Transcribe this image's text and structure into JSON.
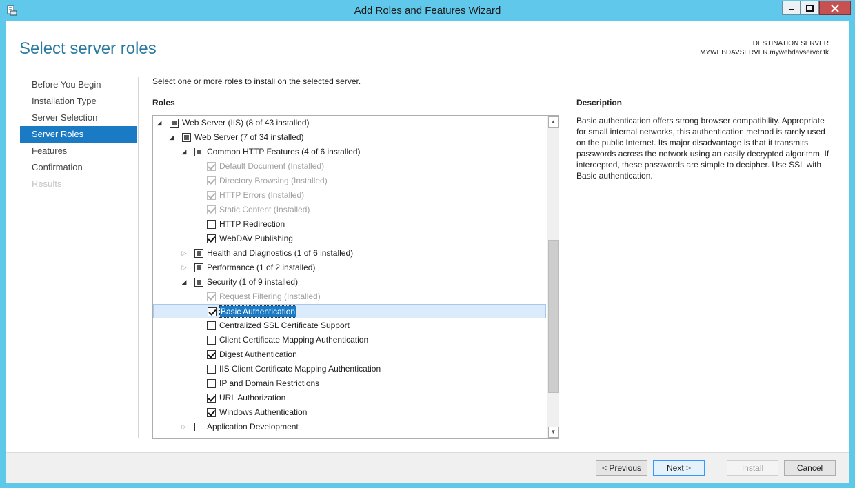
{
  "window": {
    "title": "Add Roles and Features Wizard"
  },
  "header": {
    "page_title": "Select server roles",
    "destination_label": "DESTINATION SERVER",
    "destination_server": "MYWEBDAVSERVER.mywebdavserver.tk"
  },
  "nav": {
    "items": [
      {
        "label": "Before You Begin",
        "state": "normal"
      },
      {
        "label": "Installation Type",
        "state": "normal"
      },
      {
        "label": "Server Selection",
        "state": "normal"
      },
      {
        "label": "Server Roles",
        "state": "active"
      },
      {
        "label": "Features",
        "state": "normal"
      },
      {
        "label": "Confirmation",
        "state": "normal"
      },
      {
        "label": "Results",
        "state": "disabled"
      }
    ]
  },
  "main": {
    "instruction": "Select one or more roles to install on the selected server.",
    "roles_label": "Roles",
    "tree": [
      {
        "label": "Web Server (IIS) (8 of 43 installed)",
        "level": 0,
        "expander": "expanded",
        "check": "partial",
        "disabled": false
      },
      {
        "label": "Web Server (7 of 34 installed)",
        "level": 1,
        "expander": "expanded",
        "check": "partial",
        "disabled": false
      },
      {
        "label": "Common HTTP Features (4 of 6 installed)",
        "level": 2,
        "expander": "expanded",
        "check": "partial",
        "disabled": false
      },
      {
        "label": "Default Document (Installed)",
        "level": 3,
        "expander": "none",
        "check": "checked",
        "disabled": true
      },
      {
        "label": "Directory Browsing (Installed)",
        "level": 3,
        "expander": "none",
        "check": "checked",
        "disabled": true
      },
      {
        "label": "HTTP Errors (Installed)",
        "level": 3,
        "expander": "none",
        "check": "checked",
        "disabled": true
      },
      {
        "label": "Static Content (Installed)",
        "level": 3,
        "expander": "none",
        "check": "checked",
        "disabled": true
      },
      {
        "label": "HTTP Redirection",
        "level": 3,
        "expander": "none",
        "check": "unchecked",
        "disabled": false
      },
      {
        "label": "WebDAV Publishing",
        "level": 3,
        "expander": "none",
        "check": "checked",
        "disabled": false
      },
      {
        "label": "Health and Diagnostics (1 of 6 installed)",
        "level": 2,
        "expander": "collapsed",
        "check": "partial",
        "disabled": false
      },
      {
        "label": "Performance (1 of 2 installed)",
        "level": 2,
        "expander": "collapsed",
        "check": "partial",
        "disabled": false
      },
      {
        "label": "Security (1 of 9 installed)",
        "level": 2,
        "expander": "expanded",
        "check": "partial",
        "disabled": false
      },
      {
        "label": "Request Filtering (Installed)",
        "level": 3,
        "expander": "none",
        "check": "checked",
        "disabled": true
      },
      {
        "label": "Basic Authentication",
        "level": 3,
        "expander": "none",
        "check": "checked",
        "disabled": false,
        "selected": true
      },
      {
        "label": "Centralized SSL Certificate Support",
        "level": 3,
        "expander": "none",
        "check": "unchecked",
        "disabled": false
      },
      {
        "label": "Client Certificate Mapping Authentication",
        "level": 3,
        "expander": "none",
        "check": "unchecked",
        "disabled": false
      },
      {
        "label": "Digest Authentication",
        "level": 3,
        "expander": "none",
        "check": "checked",
        "disabled": false
      },
      {
        "label": "IIS Client Certificate Mapping Authentication",
        "level": 3,
        "expander": "none",
        "check": "unchecked",
        "disabled": false
      },
      {
        "label": "IP and Domain Restrictions",
        "level": 3,
        "expander": "none",
        "check": "unchecked",
        "disabled": false
      },
      {
        "label": "URL Authorization",
        "level": 3,
        "expander": "none",
        "check": "checked",
        "disabled": false
      },
      {
        "label": "Windows Authentication",
        "level": 3,
        "expander": "none",
        "check": "checked",
        "disabled": false
      },
      {
        "label": "Application Development",
        "level": 2,
        "expander": "collapsed",
        "check": "unchecked",
        "disabled": false
      }
    ]
  },
  "description": {
    "label": "Description",
    "text": "Basic authentication offers strong browser compatibility. Appropriate for small internal networks, this authentication method is rarely used on the public Internet. Its major disadvantage is that it transmits passwords across the network using an easily decrypted algorithm. If intercepted, these passwords are simple to decipher. Use SSL with Basic authentication."
  },
  "footer": {
    "previous_label": "< Previous",
    "next_label": "Next >",
    "install_label": "Install",
    "cancel_label": "Cancel"
  },
  "colors": {
    "titlebar": "#60c8ea",
    "accent": "#1a7ac4",
    "page_title": "#2a7aa0"
  }
}
